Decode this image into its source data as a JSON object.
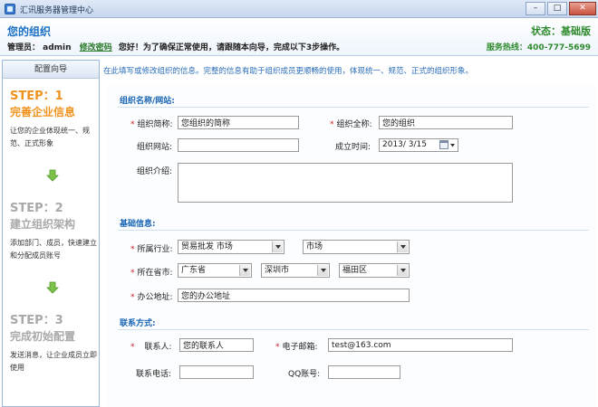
{
  "window": {
    "title": "汇讯服务器管理中心",
    "minimize": "–",
    "maximize": "□",
    "close": "✕"
  },
  "header": {
    "page_title": "您的组织",
    "status": "状态：基础版",
    "admin_label": "管理员：",
    "admin_name": "admin",
    "change_password": "修改密码",
    "guide_text": "您好！为了确保正常使用，请跟随本向导，完成以下3步操作。",
    "hotline": "服务热线：400-777-5699"
  },
  "sidebar": {
    "heading": "配置向导",
    "steps": [
      {
        "no": "STEP：1",
        "title": "完善企业信息",
        "desc": "让您的企业体现统一、规范、正式形象"
      },
      {
        "no": "STEP：2",
        "title": "建立组织架构",
        "desc": "添加部门、成员，快速建立和分配成员账号"
      },
      {
        "no": "STEP：3",
        "title": "完成初始配置",
        "desc": "发送消息，让企业成员立即使用"
      }
    ]
  },
  "main": {
    "notice": "在此填写或修改组织的信息。完整的信息有助于组织成员更顺畅的使用，体现统一、规范、正式的组织形象。",
    "org": {
      "section_title": "组织名称/网站:",
      "short_name_label": "组织简称:",
      "short_name_value": "您组织的简称",
      "full_name_label": "组织全称:",
      "full_name_value": "您的组织",
      "website_label": "组织网站:",
      "website_value": "",
      "founded_label": "成立时间:",
      "founded_value": "2013/ 3/15",
      "intro_label": "组织介绍:",
      "intro_value": ""
    },
    "basic": {
      "section_title": "基础信息:",
      "industry_label": "所属行业:",
      "industry_value": "贸易批发 市场",
      "industry_sub_value": "市场",
      "region_label": "所在省市:",
      "province_value": "广东省",
      "city_value": "深圳市",
      "district_value": "福田区",
      "address_label": "办公地址:",
      "address_value": "您的办公地址"
    },
    "contact": {
      "section_title": "联系方式:",
      "person_label": "联系人:",
      "person_value": "您的联系人",
      "email_label": "电子邮箱:",
      "email_value": "test@163.com",
      "phone_label": "联系电话:",
      "phone_value": "",
      "qq_label": "QQ账号:",
      "qq_value": ""
    }
  },
  "colors": {
    "accent": "#1a6fc4",
    "active_step": "#f0921e",
    "inactive_step": "#a9a9a9",
    "status_green": "#2d8a2d",
    "required": "#d12020"
  }
}
